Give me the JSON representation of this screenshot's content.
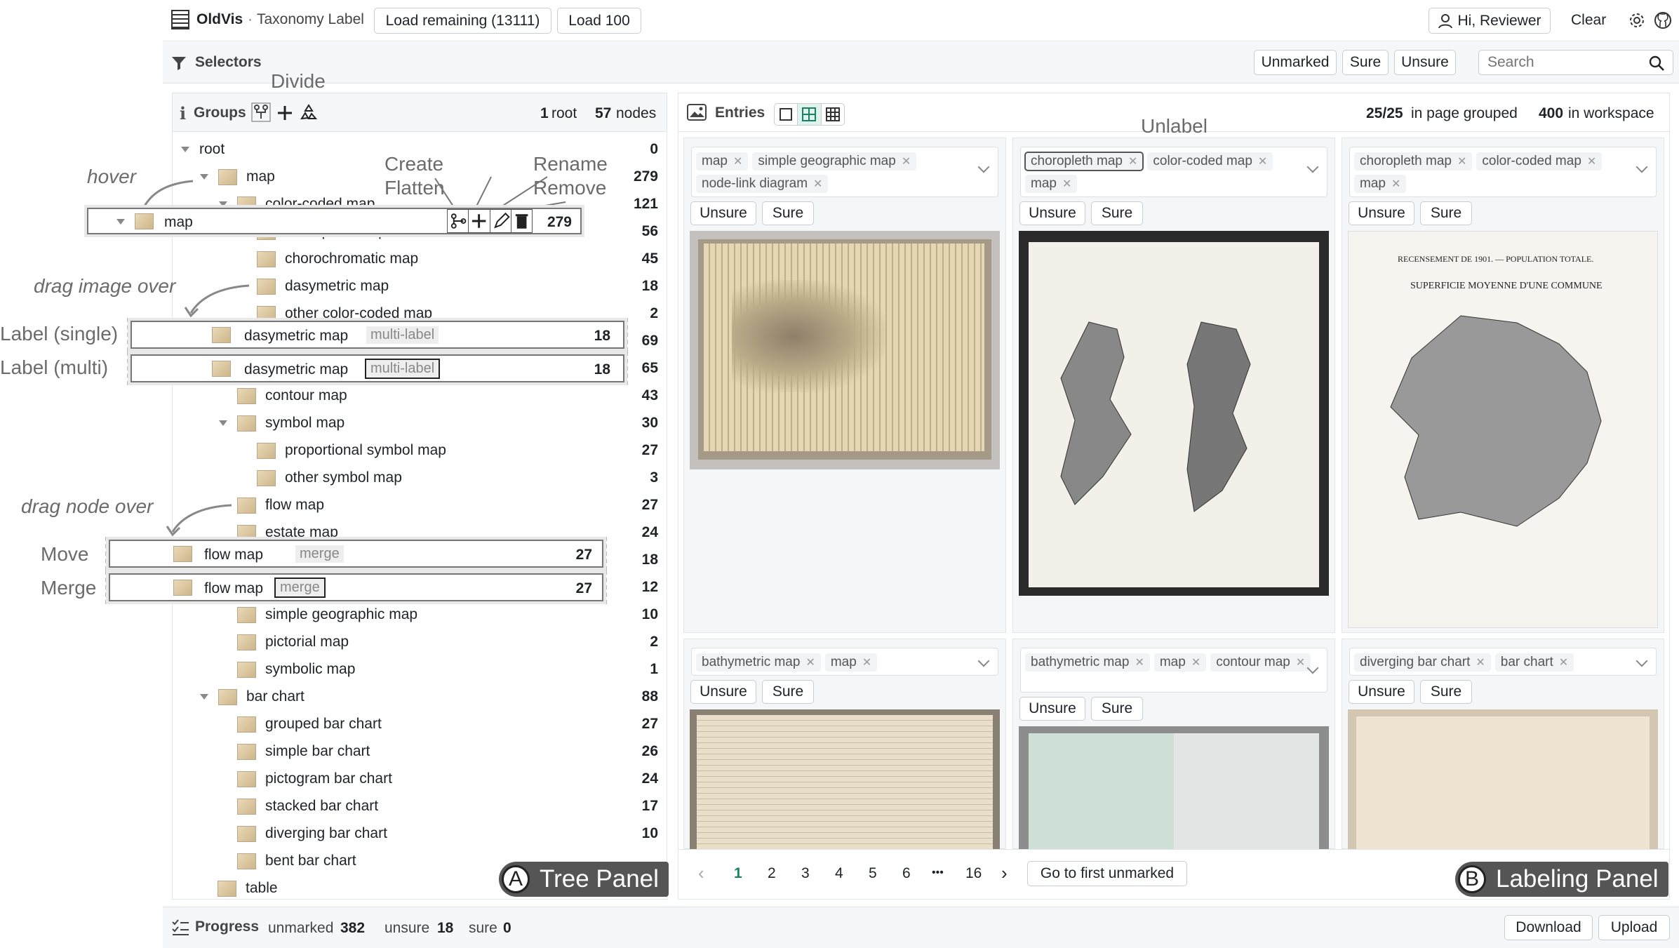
{
  "topbar": {
    "app_name": "OldVis",
    "separator": "·",
    "subtitle": "Taxonomy Label",
    "load_remaining": "Load remaining (13111)",
    "load_100": "Load 100",
    "user": "Hi, Reviewer",
    "clear": "Clear"
  },
  "selectors": {
    "label": "Selectors",
    "unmarked": "Unmarked",
    "sure": "Sure",
    "unsure": "Unsure",
    "search_placeholder": "Search"
  },
  "groups": {
    "label": "Groups",
    "root_count": "1",
    "root_label": "root",
    "node_count": "57",
    "node_label": "nodes"
  },
  "annotations": {
    "divide": "Divide",
    "create": "Create",
    "flatten": "Flatten",
    "rename": "Rename",
    "remove": "Remove",
    "unlabel": "Unlabel",
    "hover": "hover",
    "drag_image": "drag image over",
    "label_single": "Label (single)",
    "label_multi": "Label (multi)",
    "drag_node": "drag node over",
    "move": "Move",
    "merge": "Merge"
  },
  "tree": [
    {
      "label": "root",
      "count": "0"
    },
    {
      "label": "map",
      "count": "279"
    },
    {
      "label": "color-coded map",
      "count": "121"
    },
    {
      "label": "choropleth map",
      "count": "56"
    },
    {
      "label": "chorochromatic map",
      "count": "45"
    },
    {
      "label": "dasymetric map",
      "count": "18"
    },
    {
      "label": "other color-coded map",
      "count": "2"
    },
    {
      "label": "",
      "count": "69"
    },
    {
      "label": "",
      "count": "65"
    },
    {
      "label": "contour map",
      "count": "43"
    },
    {
      "label": "symbol map",
      "count": "30"
    },
    {
      "label": "proportional symbol map",
      "count": "27"
    },
    {
      "label": "other symbol map",
      "count": "3"
    },
    {
      "label": "flow map",
      "count": "27"
    },
    {
      "label": "estate map",
      "count": "24"
    },
    {
      "label": "",
      "count": "18"
    },
    {
      "label": "",
      "count": "12"
    },
    {
      "label": "simple geographic map",
      "count": "10"
    },
    {
      "label": "pictorial map",
      "count": "2"
    },
    {
      "label": "symbolic map",
      "count": "1"
    },
    {
      "label": "bar chart",
      "count": "88"
    },
    {
      "label": "grouped bar chart",
      "count": "27"
    },
    {
      "label": "simple bar chart",
      "count": "26"
    },
    {
      "label": "pictogram bar chart",
      "count": "24"
    },
    {
      "label": "stacked bar chart",
      "count": "17"
    },
    {
      "label": "diverging bar chart",
      "count": "10"
    },
    {
      "label": "bent bar chart",
      "count": ""
    },
    {
      "label": "table",
      "count": ""
    }
  ],
  "ghosts": {
    "hover": {
      "label": "map",
      "count": "279"
    },
    "single": {
      "label": "dasymetric map",
      "tag": "multi-label",
      "count": "18"
    },
    "multi": {
      "label": "dasymetric map",
      "tag": "multi-label",
      "count": "18"
    },
    "move": {
      "label": "flow map",
      "tag": "merge",
      "count": "27"
    },
    "merge": {
      "label": "flow map",
      "tag": "merge",
      "count": "27"
    }
  },
  "entries": {
    "label": "Entries",
    "grouped": "25/25",
    "grouped_label": "in page grouped",
    "workspace": "400",
    "workspace_label": "in workspace"
  },
  "cards": [
    {
      "tags": [
        "map",
        "simple geographic map",
        "node-link diagram"
      ],
      "unsure": "Unsure",
      "sure": "Sure"
    },
    {
      "tags": [
        "choropleth map",
        "color-coded map",
        "map"
      ],
      "unsure": "Unsure",
      "sure": "Sure"
    },
    {
      "tags": [
        "choropleth map",
        "color-coded map",
        "map"
      ],
      "unsure": "Unsure",
      "sure": "Sure",
      "image_title": "RECENSEMENT DE 1901. — POPULATION TOTALE.",
      "image_subtitle": "SUPERFICIE MOYENNE D'UNE COMMUNE"
    },
    {
      "tags": [
        "bathymetric map",
        "map"
      ],
      "unsure": "Unsure",
      "sure": "Sure"
    },
    {
      "tags": [
        "bathymetric map",
        "map",
        "contour map"
      ],
      "unsure": "Unsure",
      "sure": "Sure"
    },
    {
      "tags": [
        "diverging bar chart",
        "bar chart"
      ],
      "unsure": "Unsure",
      "sure": "Sure"
    }
  ],
  "pagination": {
    "prev": "‹",
    "pages": [
      "1",
      "2",
      "3",
      "4",
      "5",
      "6",
      "•••",
      "16"
    ],
    "next": "›",
    "goto": "Go to first unmarked"
  },
  "panels": {
    "a_letter": "A",
    "a_label": "Tree Panel",
    "b_letter": "B",
    "b_label": "Labeling Panel"
  },
  "progress": {
    "label": "Progress",
    "unmarked_label": "unmarked",
    "unmarked": "382",
    "unsure_label": "unsure",
    "unsure": "18",
    "sure_label": "sure",
    "sure": "0",
    "download": "Download",
    "upload": "Upload"
  },
  "colors": {
    "accent": "#1a7f64",
    "border": "#d0d7de",
    "panel_bg": "#f6f7f9"
  }
}
